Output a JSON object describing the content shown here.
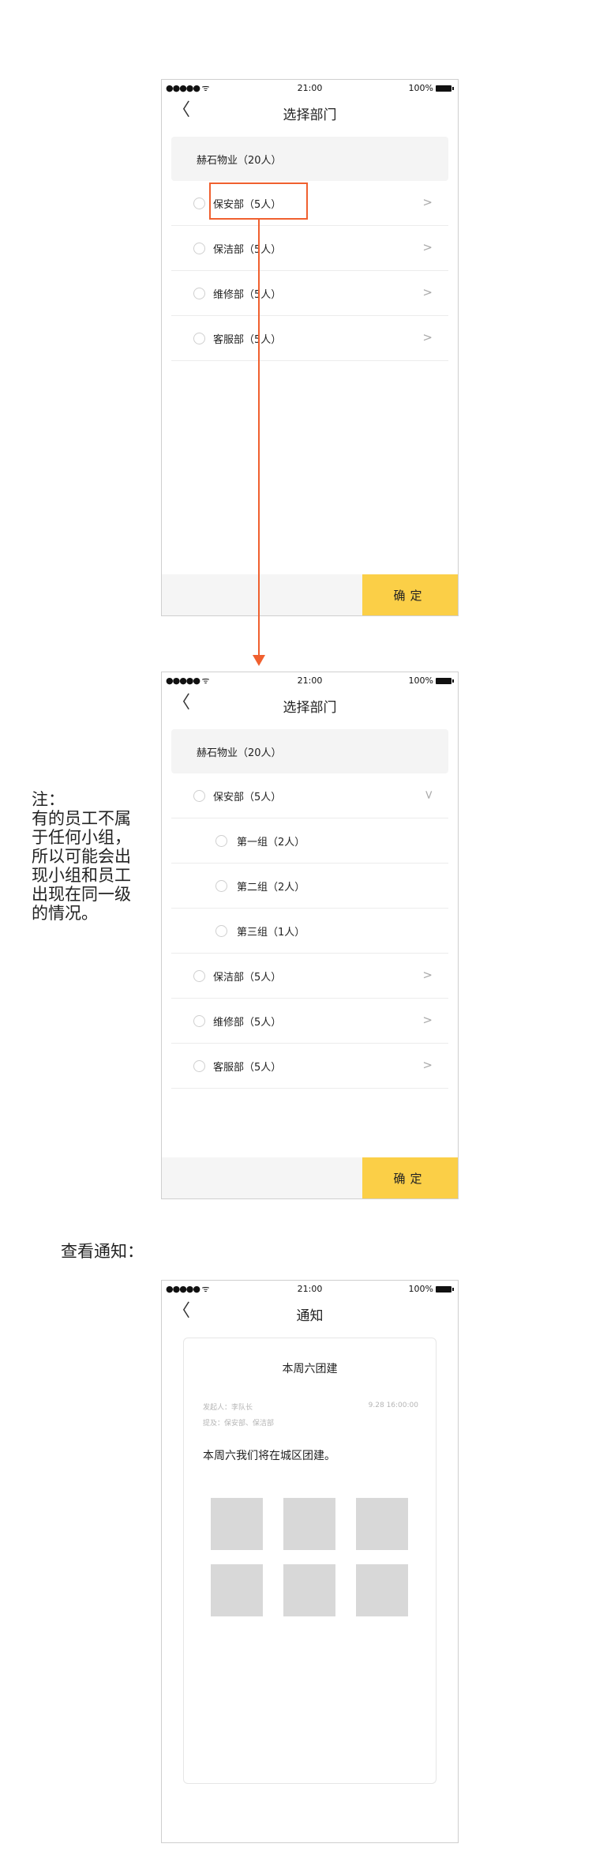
{
  "status": {
    "signal": "●●●●● ᯤ",
    "time": "21:00",
    "battery": "100%"
  },
  "screen1": {
    "nav": {
      "back": "〈",
      "title": "选择部门"
    },
    "company": "赫石物业（20人）",
    "departments": [
      {
        "label": "保安部（5人）"
      },
      {
        "label": "保洁部（5人）"
      },
      {
        "label": "维修部（5人）"
      },
      {
        "label": "客服部（5人）"
      }
    ],
    "confirm": "确定"
  },
  "screen2": {
    "nav": {
      "back": "〈",
      "title": "选择部门"
    },
    "company": "赫石物业（20人）",
    "expanded": {
      "label": "保安部（5人）"
    },
    "groups": [
      {
        "label": "第一组（2人）"
      },
      {
        "label": "第二组（2人）"
      },
      {
        "label": "第三组（1人）"
      }
    ],
    "departments": [
      {
        "label": "保洁部（5人）"
      },
      {
        "label": "维修部（5人）"
      },
      {
        "label": "客服部（5人）"
      }
    ],
    "confirm": "确定"
  },
  "note": {
    "title": "注：",
    "lines": [
      "有的员工不属",
      "于任何小组，",
      "所以可能会出",
      "现小组和员工",
      "出现在同一级",
      "的情况。"
    ]
  },
  "section2_heading": "查看通知：",
  "screen3": {
    "nav": {
      "back": "〈",
      "title": "通知"
    },
    "notice": {
      "title": "本周六团建",
      "sender": "发起人：李队长",
      "time": "9.28 16:00:00",
      "mentions": "提及：保安部、保洁部",
      "body": "本周六我们将在城区团建。"
    },
    "image_count": 6
  },
  "colors": {
    "accent": "#fbcf47",
    "annotation": "#f0602f"
  }
}
